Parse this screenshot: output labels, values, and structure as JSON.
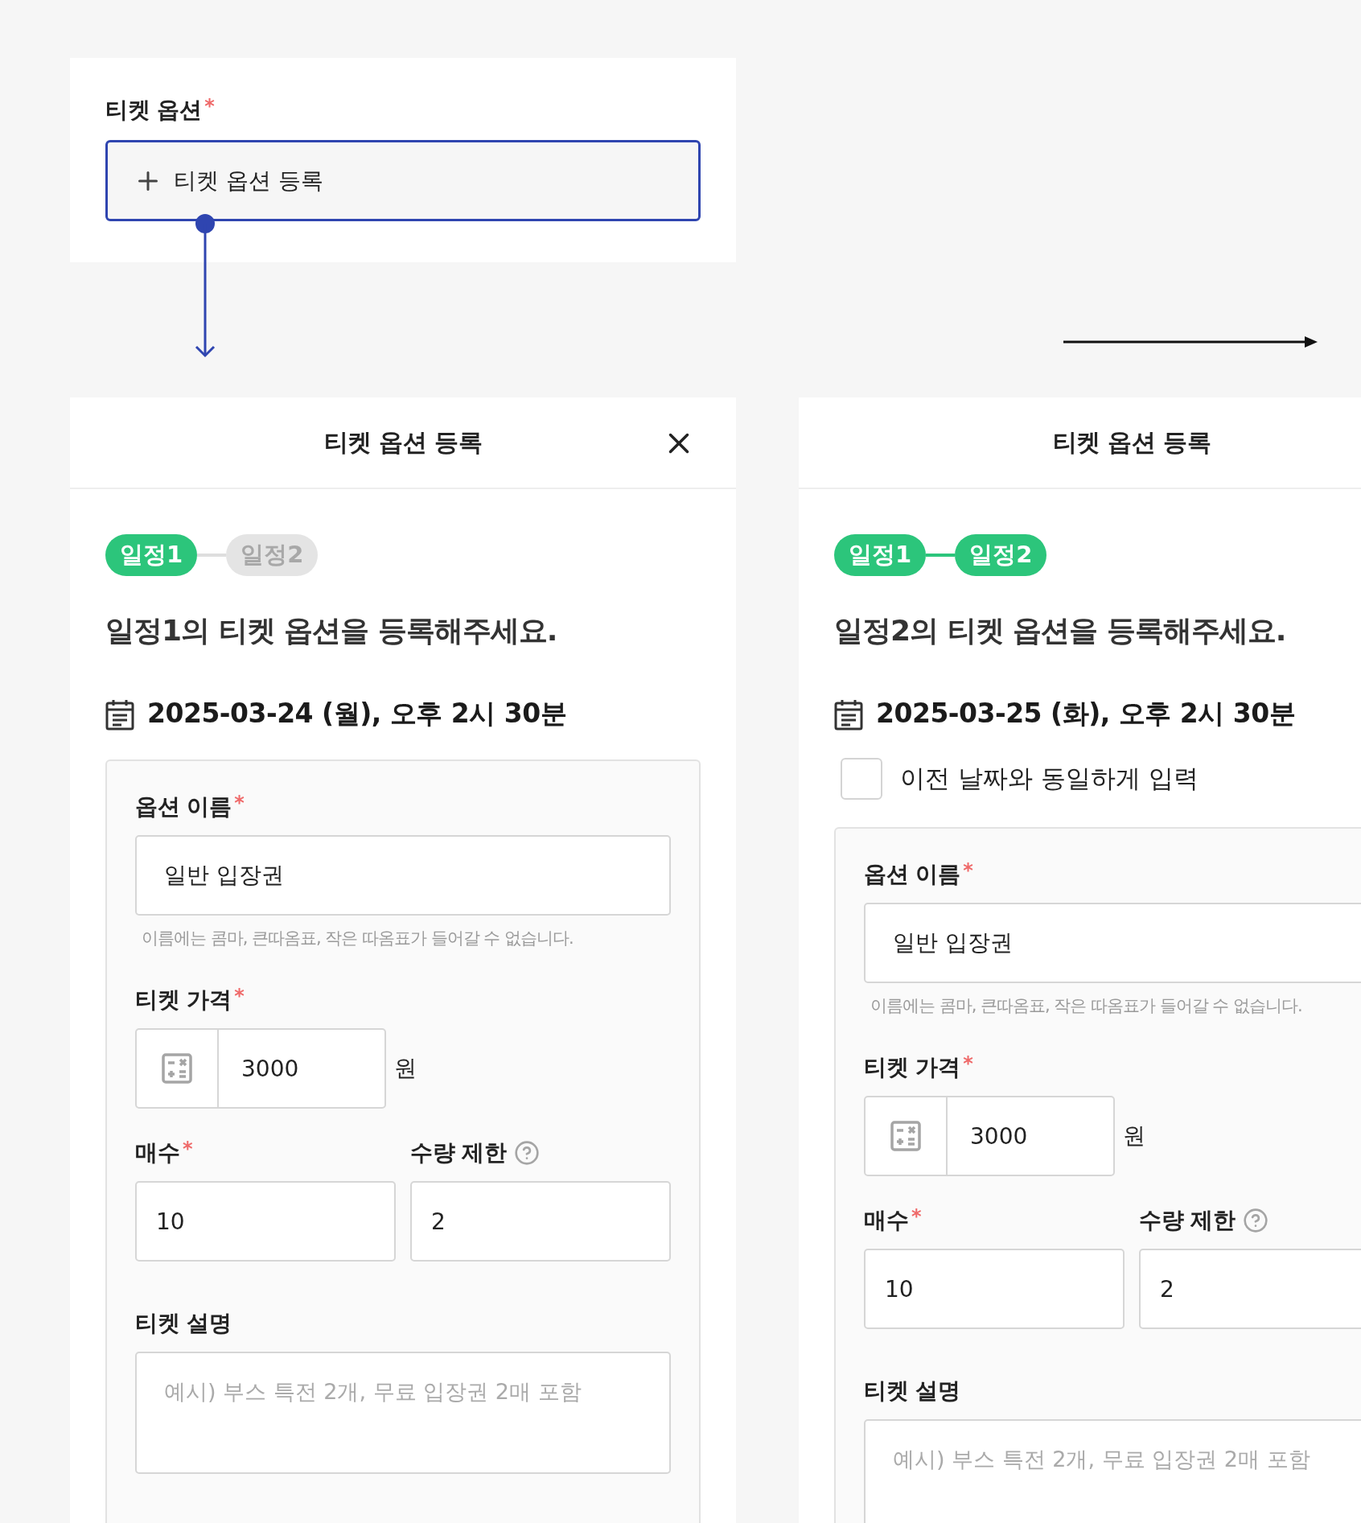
{
  "required_mark": "*",
  "ticket_option_field": {
    "label": "티켓 옵션",
    "required": true,
    "button": "티켓 옵션 등록"
  },
  "panels": [
    {
      "title": "티켓 옵션 등록",
      "closable": true,
      "steps": [
        {
          "label": "일정1",
          "active": true
        },
        {
          "label": "일정2",
          "active": false
        }
      ],
      "heading": "일정1의 티켓 옵션을 등록해주세요.",
      "date": "2025-03-24 (월), 오후 2시 30분",
      "form": {
        "option_name": {
          "label": "옵션 이름",
          "required": true,
          "value": "일반 입장권",
          "hint": "이름에는 콤마, 큰따옴표, 작은 따옴표가 들어갈 수 없습니다."
        },
        "price": {
          "label": "티켓 가격",
          "required": true,
          "value": "3000",
          "unit": "원"
        },
        "quantity": {
          "label": "매수",
          "required": true,
          "value": "10"
        },
        "limit": {
          "label": "수량 제한",
          "help": true,
          "value": "2"
        },
        "description": {
          "label": "티켓 설명",
          "placeholder": "예시) 부스 특전 2개, 무료 입장권 2매 포함"
        }
      }
    },
    {
      "title": "티켓 옵션 등록",
      "steps": [
        {
          "label": "일정1",
          "active": true
        },
        {
          "label": "일정2",
          "active": true
        }
      ],
      "heading": "일정2의 티켓 옵션을 등록해주세요.",
      "date": "2025-03-25 (화), 오후 2시 30분",
      "same_as_previous": {
        "label": "이전 날짜와 동일하게 입력",
        "checked": false
      },
      "form": {
        "option_name": {
          "label": "옵션 이름",
          "required": true,
          "value": "일반 입장권",
          "hint": "이름에는 콤마, 큰따옴표, 작은 따옴표가 들어갈 수 없습니다."
        },
        "price": {
          "label": "티켓 가격",
          "required": true,
          "value": "3000",
          "unit": "원"
        },
        "quantity": {
          "label": "매수",
          "required": true,
          "value": "10"
        },
        "limit": {
          "label": "수량 제한",
          "help": true,
          "value": "2"
        },
        "description": {
          "label": "티켓 설명",
          "placeholder": "예시) 부스 특전 2개, 무료 입장권 2매 포함"
        }
      }
    }
  ]
}
